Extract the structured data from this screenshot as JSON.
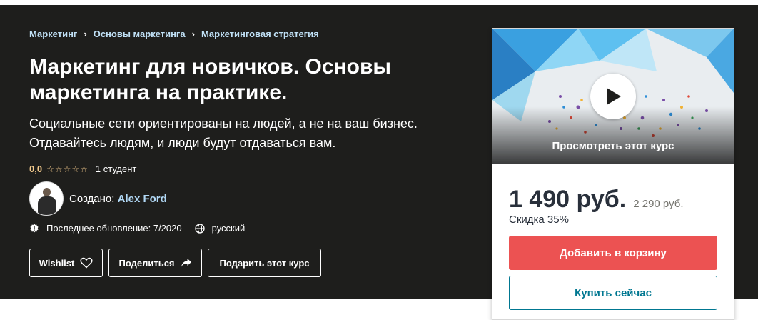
{
  "breadcrumb": {
    "items": [
      "Маркетинг",
      "Основы маркетинга",
      "Маркетинговая стратегия"
    ]
  },
  "course": {
    "title": "Маркетинг для новичков. Основы маркетинга на практике.",
    "subtitle": "Социальные сети ориентированы на людей, а не на ваш бизнес. Отдавайтесь людям, и люди будут отдаваться вам.",
    "rating": "0,0",
    "stars": 0,
    "students": "1 студент",
    "created_by_label": "Создано:",
    "author": "Alex Ford",
    "last_updated": "Последнее обновление: 7/2020",
    "language": "русский"
  },
  "actions": {
    "wishlist": "Wishlist",
    "share": "Поделиться",
    "gift": "Подарить этот курс"
  },
  "card": {
    "preview_label": "Просмотреть этот курс",
    "price": "1 490 руб.",
    "old_price": "2 290 руб.",
    "discount": "Скидка 35%",
    "add_to_cart": "Добавить в корзину",
    "buy_now": "Купить сейчас"
  },
  "colors": {
    "hero_bg": "#1e1e1c",
    "link": "#b1d8f5",
    "rating": "#f3ca8c",
    "cart_button": "#ec5252",
    "buy_button": "#007791"
  }
}
